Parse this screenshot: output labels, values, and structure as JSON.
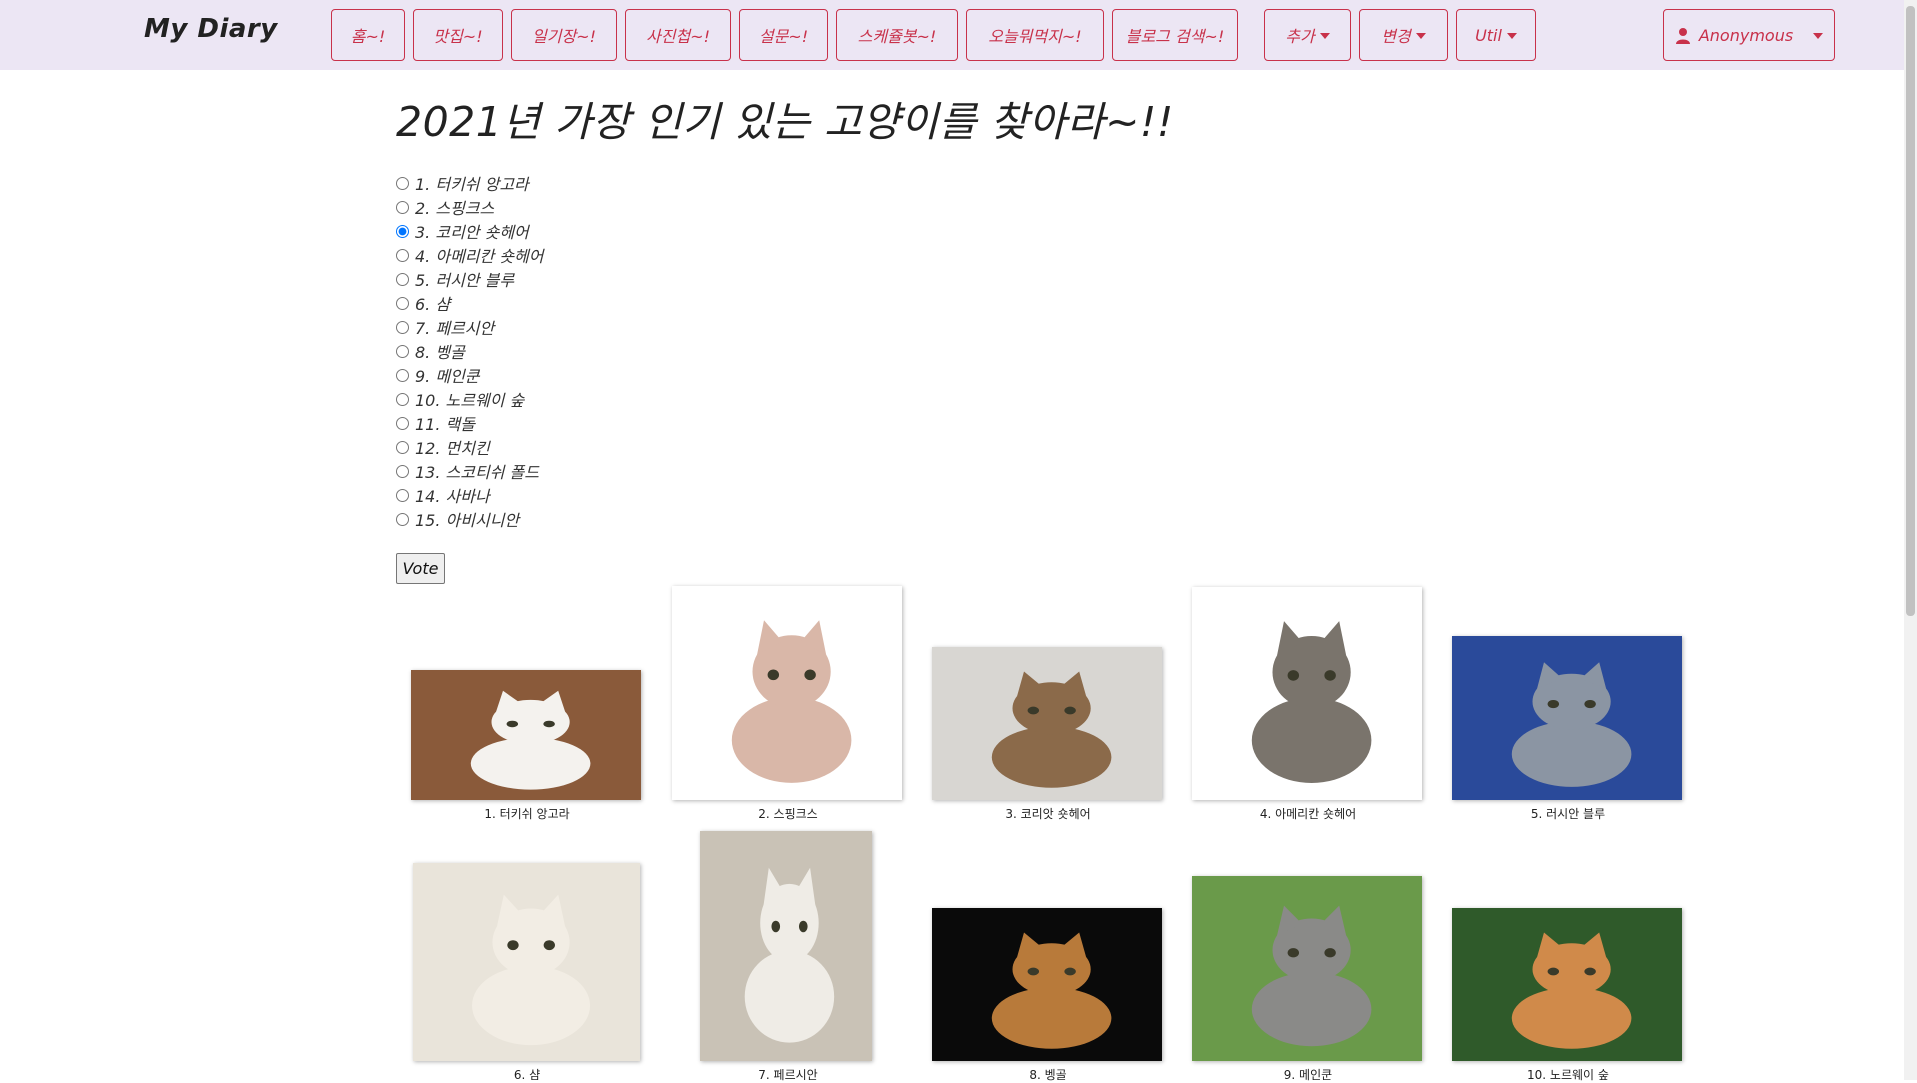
{
  "navbar": {
    "brand": "My Diary",
    "items": [
      {
        "label": "홈~!",
        "dropdown": false
      },
      {
        "label": "맛집~!",
        "dropdown": false
      },
      {
        "label": "일기장~!",
        "dropdown": false
      },
      {
        "label": "사진첩~!",
        "dropdown": false
      },
      {
        "label": "설문~!",
        "dropdown": false
      },
      {
        "label": "스케쥴봇~!",
        "dropdown": false
      },
      {
        "label": "오늘뭐먹지~!",
        "dropdown": false
      },
      {
        "label": "블로그 검색~!",
        "dropdown": false
      },
      {
        "label": "추가",
        "dropdown": true
      },
      {
        "label": "변경",
        "dropdown": true
      },
      {
        "label": "Util",
        "dropdown": true
      }
    ],
    "user": {
      "label": "Anonymous",
      "icon": "user-icon"
    },
    "accent_color": "#c8314a",
    "background_color": "#ece6f4"
  },
  "survey": {
    "title": "2021년 가장 인기 있는 고양이를 찾아라~!!",
    "options": [
      {
        "label": "1. 터키쉬 앙고라",
        "checked": false
      },
      {
        "label": "2. 스핑크스",
        "checked": false
      },
      {
        "label": "3. 코리안 숏헤어",
        "checked": true
      },
      {
        "label": "4. 아메리칸 숏헤어",
        "checked": false
      },
      {
        "label": "5. 러시안 블루",
        "checked": false
      },
      {
        "label": "6. 샴",
        "checked": false
      },
      {
        "label": "7. 페르시안",
        "checked": false
      },
      {
        "label": "8. 벵골",
        "checked": false
      },
      {
        "label": "9. 메인쿤",
        "checked": false
      },
      {
        "label": "10. 노르웨이 숲",
        "checked": false
      },
      {
        "label": "11. 랙돌",
        "checked": false
      },
      {
        "label": "12. 먼치킨",
        "checked": false
      },
      {
        "label": "13. 스코티쉬 폴드",
        "checked": false
      },
      {
        "label": "14. 사바나",
        "checked": false
      },
      {
        "label": "15. 아비시니안",
        "checked": false
      }
    ],
    "vote_label": "Vote"
  },
  "gallery": [
    {
      "caption": "1. 터키쉬 앙고라",
      "bg": "#8a5a3a",
      "cat": "#f4f2ee"
    },
    {
      "caption": "2. 스핑크스",
      "bg": "#ffffff",
      "cat": "#d9b7a8"
    },
    {
      "caption": "3. 코리앗 숏헤어",
      "bg": "#d8d6d2",
      "cat": "#8b6a4a"
    },
    {
      "caption": "4. 아메리칸 숏헤어",
      "bg": "#ffffff",
      "cat": "#7a746c"
    },
    {
      "caption": "5. 러시안 블루",
      "bg": "#2a4a9a",
      "cat": "#8b95a3"
    },
    {
      "caption": "6. 샴",
      "bg": "#e9e4da",
      "cat": "#f2ede4"
    },
    {
      "caption": "7. 페르시안",
      "bg": "#c9c2b6",
      "cat": "#efece6"
    },
    {
      "caption": "8. 벵골",
      "bg": "#0a0a0a",
      "cat": "#b87a3a"
    },
    {
      "caption": "9. 메인쿤",
      "bg": "#6a9a4a",
      "cat": "#8a8a88"
    },
    {
      "caption": "10. 노르웨이 숲",
      "bg": "#2f5a2a",
      "cat": "#d08a4a"
    }
  ]
}
